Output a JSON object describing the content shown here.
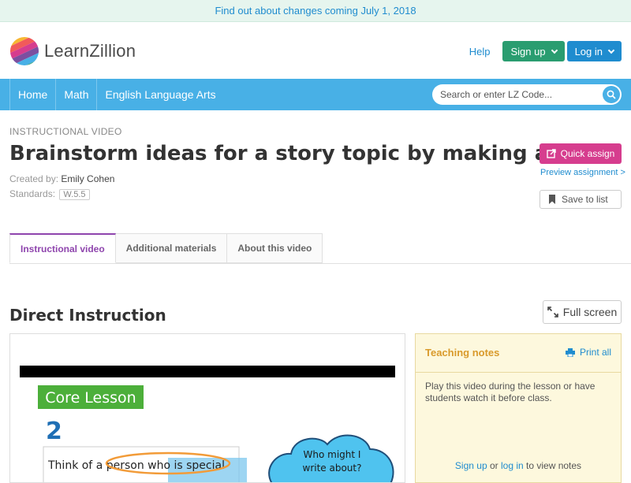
{
  "announcement": "Find out about changes coming July 1, 2018",
  "brand": {
    "name": "LearnZillion"
  },
  "top_actions": {
    "help": "Help",
    "signup": "Sign up",
    "login": "Log in"
  },
  "nav": {
    "items": [
      "Home",
      "Math",
      "English Language Arts"
    ]
  },
  "search": {
    "placeholder": "Search or enter LZ Code..."
  },
  "lesson": {
    "eyebrow": "INSTRUCTIONAL VIDEO",
    "title": "Brainstorm ideas for a story topic by making a list",
    "created_by_label": "Created by:",
    "created_by": "Emily Cohen",
    "standards_label": "Standards:",
    "standard": "W.5.5"
  },
  "actions": {
    "quick_assign": "Quick assign",
    "preview": "Preview assignment >",
    "save_to_list": "Save to list"
  },
  "tabs": [
    "Instructional video",
    "Additional materials",
    "About this video"
  ],
  "section": {
    "title": "Direct Instruction",
    "fullscreen": "Full screen"
  },
  "video": {
    "core_lesson": "Core Lesson",
    "step": "2",
    "prompt": "Think of a person who is special",
    "bubble_line1": "Who might I",
    "bubble_line2": "write about?"
  },
  "notes": {
    "title": "Teaching notes",
    "print_all": "Print all",
    "body": "Play this video during the lesson or have students watch it before class.",
    "signup": "Sign up",
    "or": "or",
    "login": "log in",
    "suffix": "to view notes"
  },
  "colors": {
    "nav_blue": "#48b0e6",
    "signup_green": "#2a9d70",
    "login_blue": "#1f8ccf",
    "assign_pink": "#d63d8e",
    "tab_purple": "#8e44ad",
    "notes_orange": "#d99a2b"
  }
}
